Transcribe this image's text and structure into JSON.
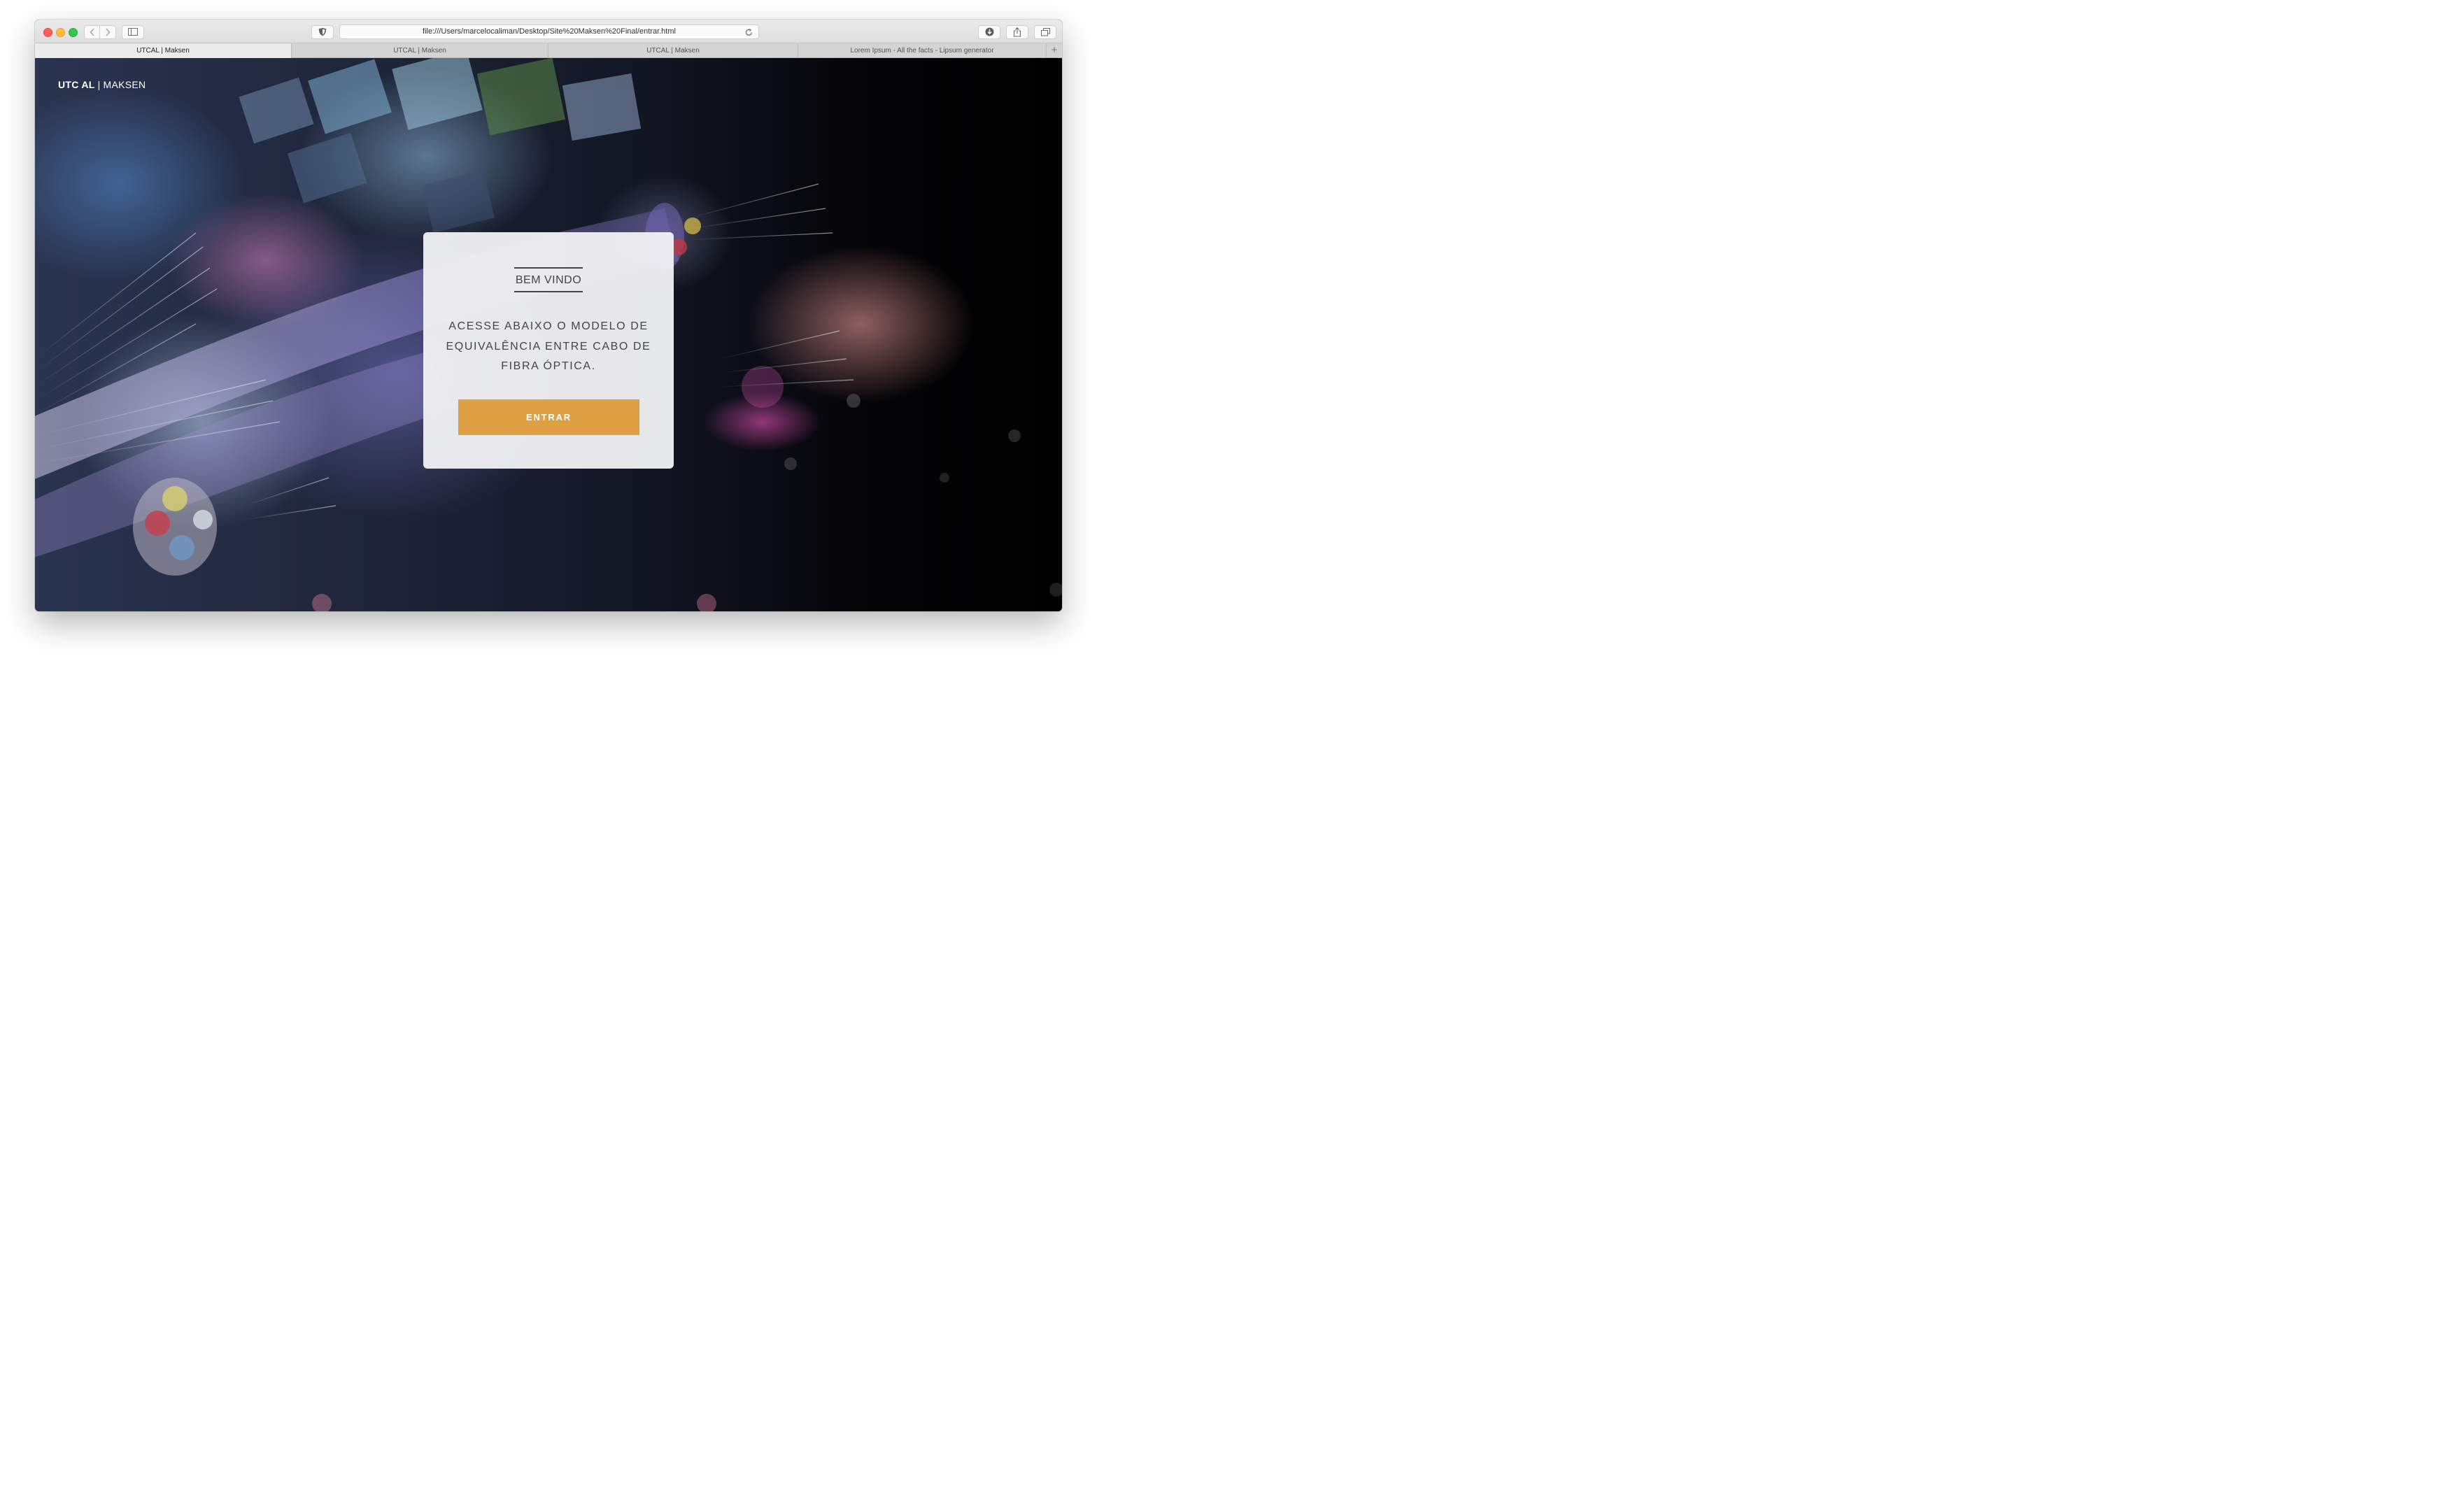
{
  "browser": {
    "address_url": "file:///Users/marcelocaliman/Desktop/Site%20Maksen%20Final/entrar.html",
    "tabs": [
      {
        "label": "UTCAL | Maksen"
      },
      {
        "label": "UTCAL | Maksen"
      },
      {
        "label": "UTCAL | Maksen"
      },
      {
        "label": "Lorem Ipsum - All the facts - Lipsum generator"
      }
    ],
    "new_tab_glyph": "+",
    "icons": {
      "back": "chevron-left-icon",
      "forward": "chevron-right-icon",
      "sidebar": "sidebar-icon",
      "privacy": "shield-icon",
      "reload": "reload-icon",
      "downloads": "download-icon",
      "share": "share-icon",
      "tabs_overview": "tabs-overview-icon"
    },
    "traffic_light_colors": {
      "close": "#fc605c",
      "minimize": "#fdbc40",
      "zoom": "#34c84a"
    }
  },
  "page": {
    "brand": {
      "bold": "UTC AL",
      "separator": "|",
      "name": "MAKSEN"
    },
    "card": {
      "title": "BEM VINDO",
      "text": "ACESSE ABAIXO O MODELO DE EQUIVALÊNCIA ENTRE CABO DE FIBRA ÓPTICA.",
      "button_label": "ENTRAR"
    },
    "colors": {
      "accent": "#dfa044",
      "card_bg": "#f2f2f4",
      "text": "#444444"
    }
  }
}
